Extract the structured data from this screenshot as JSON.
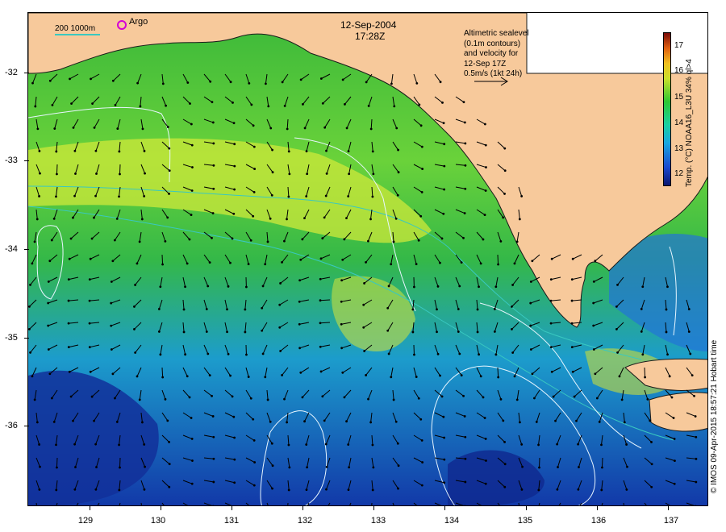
{
  "title": {
    "date": "12-Sep-2004",
    "time": "17:28Z"
  },
  "scale_bar": {
    "label": "200  1000m",
    "color": "#39c8c0"
  },
  "argo": {
    "label": "Argo",
    "color": "#d400d4"
  },
  "annotation": {
    "lines": [
      "Altimetric sealevel",
      "(0.1m contours)",
      "and velocity for",
      "12-Sep 17Z",
      "0.5m/s (1kt 24h)"
    ]
  },
  "colorbar": {
    "title": "Temp. (°C) NOAA16_L3U 34% ql>4",
    "labels": [
      "17",
      "16",
      "15",
      "14",
      "13",
      "12"
    ]
  },
  "credit": "© IMOS 09-Apr-2015 18:57:21 Hobart time",
  "axes": {
    "y_labels": [
      "-32",
      "-33",
      "-34",
      "-35",
      "-36"
    ],
    "x_labels": [
      "129",
      "130",
      "131",
      "132",
      "133",
      "134",
      "135",
      "136",
      "137"
    ]
  },
  "colors": {
    "land": "#f7c99b",
    "coast": "#1a1a1a",
    "contour": "#e8f6ff",
    "isobath": "#39c8c0",
    "arrow": "#000000"
  }
}
